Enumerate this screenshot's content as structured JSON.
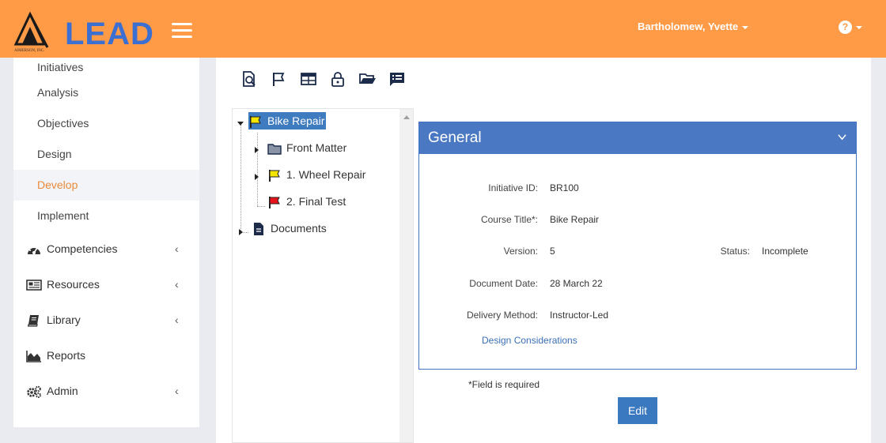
{
  "header": {
    "logo_text": "LEAD",
    "logo_subtext": "AIMERSON, INC.",
    "user_name": "Bartholomew, Yvette",
    "help_glyph": "?",
    "colors": {
      "topbar": "#ff9a47",
      "logo_blue": "#3b6fd1"
    }
  },
  "sidebar": {
    "sub_items": [
      {
        "label": "Initiatives"
      },
      {
        "label": "Analysis"
      },
      {
        "label": "Objectives"
      },
      {
        "label": "Design"
      },
      {
        "label": "Develop",
        "active": true
      },
      {
        "label": "Implement"
      }
    ],
    "nav_items": [
      {
        "label": "Competencies",
        "icon": "dashboard-icon",
        "chevron": "‹"
      },
      {
        "label": "Resources",
        "icon": "newspaper-icon",
        "chevron": "‹"
      },
      {
        "label": "Library",
        "icon": "book-icon",
        "chevron": "‹"
      },
      {
        "label": "Reports",
        "icon": "area-chart-icon"
      },
      {
        "label": "Admin",
        "icon": "cogs-icon",
        "chevron": "‹"
      }
    ],
    "active_color": "#e98a3b"
  },
  "toolbar": {
    "icons": [
      "search-document-icon",
      "flag-icon",
      "table-icon",
      "lock-icon",
      "folder-open-icon",
      "list-icon"
    ]
  },
  "tree": {
    "nodes": [
      {
        "label": "Bike Repair",
        "icon": "yellow-flag-icon",
        "selected": true
      },
      {
        "label": "Front Matter",
        "icon": "folder-icon"
      },
      {
        "label": "1. Wheel Repair",
        "icon": "yellow-flag-icon"
      },
      {
        "label": "2. Final Test",
        "icon": "red-flag-icon"
      },
      {
        "label": "Documents",
        "icon": "document-icon"
      }
    ]
  },
  "general": {
    "title": "General",
    "fields": {
      "initiative_id": {
        "label": "Initiative ID:",
        "value": "BR100"
      },
      "course_title": {
        "label": "Course Title*:",
        "value": "Bike Repair"
      },
      "version": {
        "label": "Version:",
        "value": "5"
      },
      "status": {
        "label": "Status:",
        "value": "Incomplete"
      },
      "document_date": {
        "label": "Document Date:",
        "value": "28 March 22"
      },
      "delivery_method": {
        "label": "Delivery Method:",
        "value": "Instructor-Led"
      }
    },
    "design_link": "Design Considerations",
    "header_color": "#4a78c2"
  },
  "footer": {
    "required_note": "*Field is required",
    "edit_label": "Edit"
  }
}
